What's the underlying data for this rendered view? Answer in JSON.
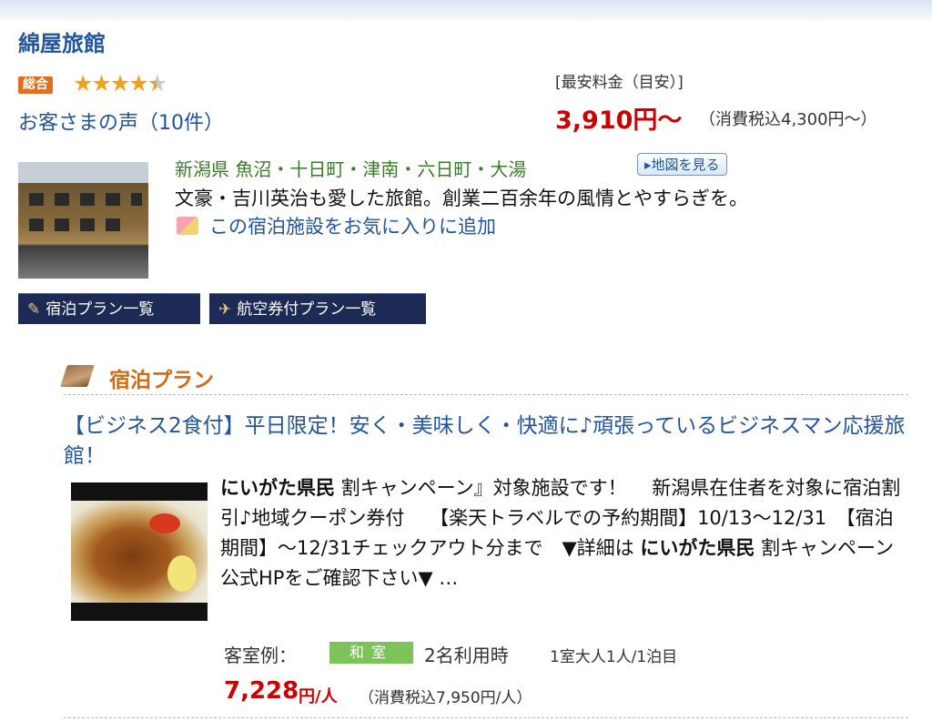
{
  "hotel": {
    "name": "綿屋旅館",
    "rating_badge": "総合",
    "rating_stars": 4.5,
    "reviews_link": "お客さまの声（10件）",
    "price_label": "[最安料金（目安）]",
    "price_main": "3,910円〜",
    "price_tax": "（消費税込4,300円〜）",
    "location": "新潟県 魚沼・十日町・津南・六日町・大湯",
    "map_button": "▸地図を見る",
    "catch_copy": "文豪・吉川英治も愛した旅館。創業二百余年の風情とやすらぎを。",
    "favorite_link": "この宿泊施設をお気に入りに追加"
  },
  "nav": {
    "stay_plans": "宿泊プラン一覧",
    "air_plans": "航空券付プラン一覧"
  },
  "section": {
    "title": "宿泊プラン"
  },
  "plan": {
    "title": "【ビジネス2食付】平日限定！安く・美味しく・快適に♪頑張っているビジネスマン応援旅館！",
    "desc_bold1": "にいがた県民",
    "desc_part1": " 割キャンペーン』対象施設です！　 新潟県在住者を対象に宿泊割引♪地域クーポン券付　 【楽天トラベルでの予約期間】10/13〜12/31　【宿泊期間】〜12/31チェックアウト分まで　▼詳細は ",
    "desc_bold2": "にいがた県民",
    "desc_part2": " 割キャンペーン公式HPをご確認下さい▼ …",
    "room_label": "客室例：",
    "room_type": "和室",
    "room_occupancy": "2名利用時",
    "room_basis": "1室大人1人/1泊目",
    "price": "7,228",
    "price_unit": "円/人",
    "price_tax": "（消費税込7,950円/人）"
  },
  "colors": {
    "link": "#22559a",
    "price": "#cc0000",
    "section_accent": "#d06b12",
    "location_green": "#3a7d28",
    "nav_button_bg": "#1c2a55",
    "room_badge_bg": "#7cc35a"
  }
}
